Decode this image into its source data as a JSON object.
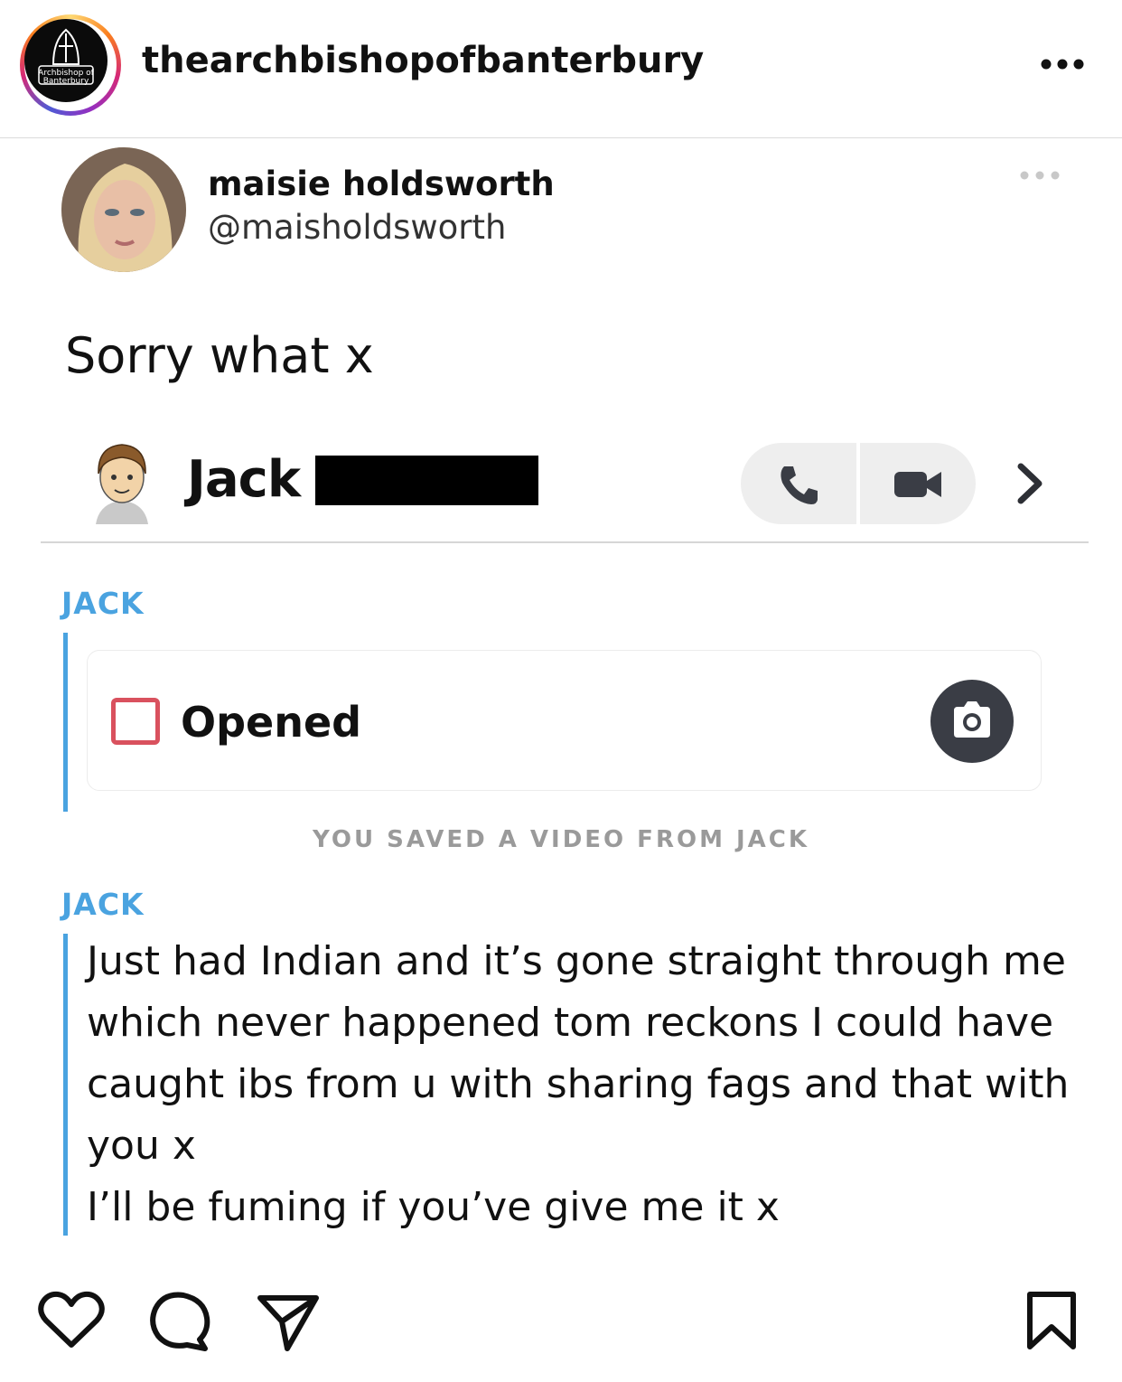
{
  "post": {
    "account": {
      "username": "thearchbishopofbanterbury",
      "avatar_text": "Archbishop of Banterbury"
    }
  },
  "tweet": {
    "display_name": "maisie holdsworth",
    "handle": "@maisholdsworth",
    "text": "Sorry what x"
  },
  "snap": {
    "contact_name": "Jack",
    "chat": [
      {
        "sender": "JACK",
        "snap_status": "Opened"
      },
      {
        "system_note": "YOU SAVED A VIDEO FROM JACK"
      },
      {
        "sender": "JACK",
        "lines": [
          "Just had Indian and it’s gone straight through me",
          "which never happened tom reckons I could have",
          "caught ibs from u with sharing fags and that with",
          "you x",
          "I’ll be fuming if you’ve give me it x"
        ]
      }
    ]
  },
  "icons": {
    "header": [
      "more-options-icon"
    ],
    "snap_header": [
      "phone-icon",
      "video-camera-icon",
      "chevron-right-icon"
    ],
    "actions": [
      "heart-icon",
      "comment-icon",
      "share-icon",
      "bookmark-icon"
    ]
  },
  "colors": {
    "accent_blue": "#4aa3e0",
    "opened_red": "#d9515e",
    "camera_button": "#3a3d45",
    "pill_gray": "#eeeeee"
  }
}
